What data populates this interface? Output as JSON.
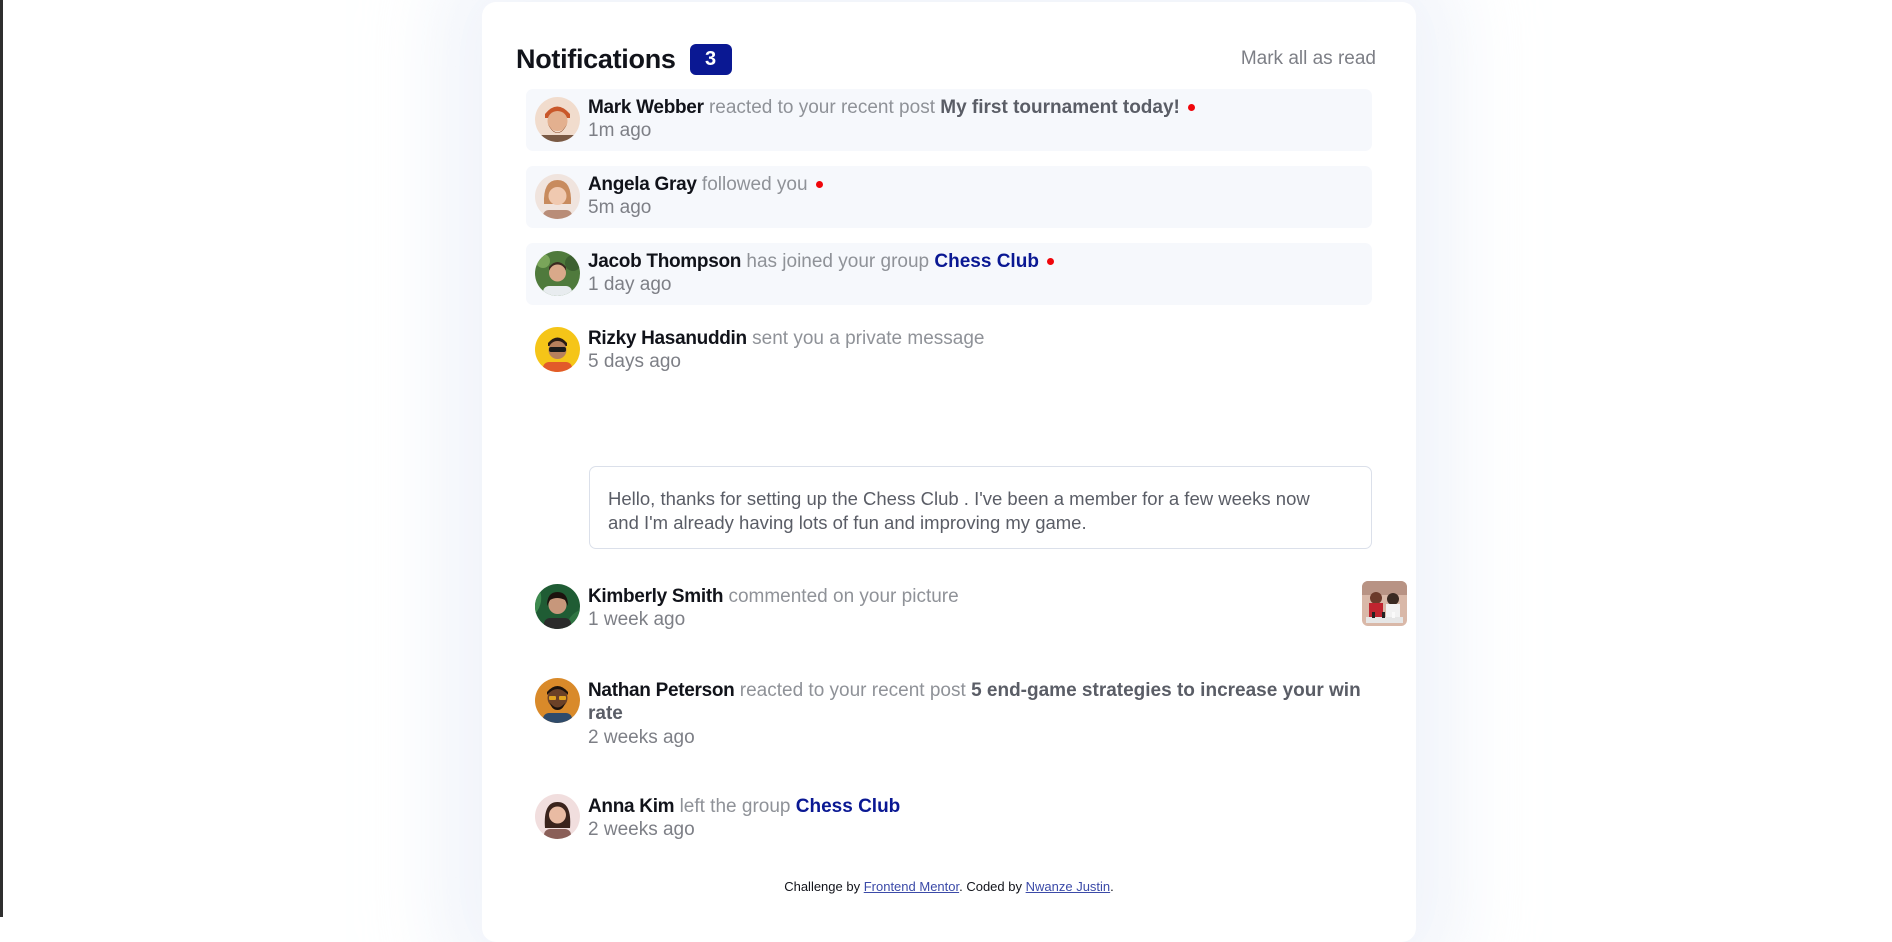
{
  "header": {
    "title": "Notifications",
    "unread_count": "3",
    "mark_all_label": "Mark all as read"
  },
  "notifications": [
    {
      "name": "Mark Webber",
      "action": "reacted to your recent post",
      "target": "My first tournament today!",
      "time": "1m ago",
      "unread": true,
      "avatar": "mark-webber-avatar"
    },
    {
      "name": "Angela Gray",
      "action": "followed you",
      "target": "",
      "time": "5m ago",
      "unread": true,
      "avatar": "angela-gray-avatar"
    },
    {
      "name": "Jacob Thompson",
      "action": "has joined your group",
      "target": "Chess Club",
      "time": "1 day ago",
      "unread": true,
      "avatar": "jacob-thompson-avatar"
    },
    {
      "name": "Rizky Hasanuddin",
      "action": "sent you a private message",
      "target": "",
      "time": "5 days ago",
      "unread": false,
      "avatar": "rizky-hasanuddin-avatar",
      "message": "Hello, thanks for setting up the Chess Club . I've been a member for a few weeks now and I'm already having lots of fun and improving my game."
    },
    {
      "name": "Kimberly Smith",
      "action": "commented on your picture",
      "target": "",
      "time": "1 week ago",
      "unread": false,
      "avatar": "kimberly-smith-avatar"
    },
    {
      "name": "Nathan Peterson",
      "action": "reacted to your recent post",
      "target": "5 end-game strategies to increase your win rate",
      "time": "2 weeks ago",
      "unread": false,
      "avatar": "nathan-peterson-avatar"
    },
    {
      "name": "Anna Kim",
      "action": "left the group",
      "target": "Chess Club",
      "time": "2 weeks ago",
      "unread": false,
      "avatar": "anna-kim-avatar"
    }
  ],
  "footer": {
    "challenge_prefix": "Challenge by",
    "challenge_link": "Frontend Mentor",
    "coded_prefix": ". Coded by",
    "coder_link": "Nwanze Justin",
    "suffix": "."
  },
  "colors": {
    "accent": "#0a1893",
    "unread_bg": "#f6f8fc",
    "dot": "#f0060b"
  }
}
